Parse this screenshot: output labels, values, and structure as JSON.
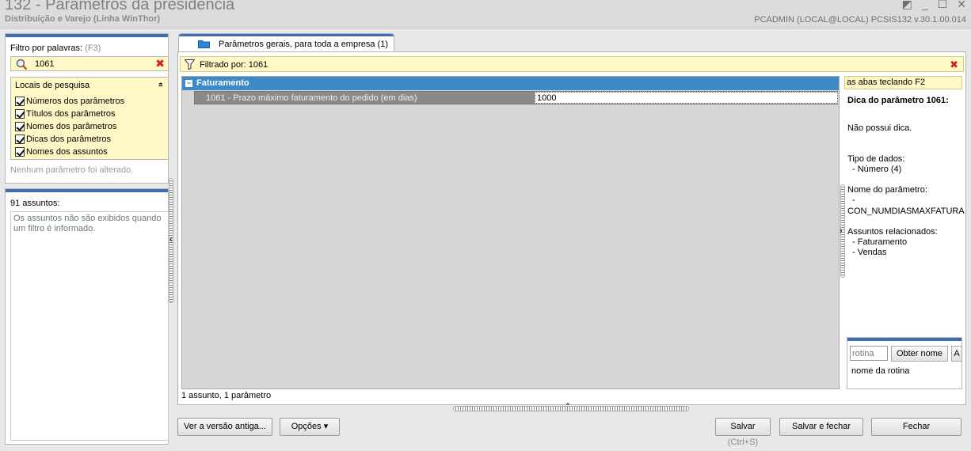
{
  "window": {
    "title": "132 - Parâmetros da presidência",
    "subtitle": "Distribuição e Varejo (Linha WinThor)",
    "user_info": "PCADMIN (LOCAL@LOCAL)   PCSIS132  v.30.1.00.014",
    "controls": {
      "restore": "◩",
      "minimize": "_",
      "maximize": "☐",
      "close": "✕"
    }
  },
  "filter": {
    "label": "Filtro por palavras:",
    "shortcut": "(F3)",
    "value": "1061",
    "clear": "✖"
  },
  "search_locations": {
    "title": "Locais de pesquisa",
    "collapse": "»",
    "items": [
      {
        "label": "Números dos parâmetros",
        "checked": true
      },
      {
        "label": "Títulos dos parâmetros",
        "checked": true
      },
      {
        "label": "Nomes dos parâmetros",
        "checked": true
      },
      {
        "label": "Dicas dos parâmetros",
        "checked": true
      },
      {
        "label": "Nomes dos assuntos",
        "checked": true
      }
    ]
  },
  "no_change_text": "Nenhum parâmetro foi alterado.",
  "subjects": {
    "count_label": "91 assuntos:",
    "message": "Os assuntos não são exibidos quando um filtro é informado."
  },
  "tab": {
    "label": "Parâmetros gerais, para toda a empresa  (1)"
  },
  "filter_bar": {
    "text": "Filtrado por: 1061",
    "close": "✖"
  },
  "grid": {
    "group": {
      "toggle": "−",
      "label": "Faturamento"
    },
    "rows": [
      {
        "name": "1061 - Prazo máximo faturamento do pedido (em dias)",
        "value": "1000"
      }
    ]
  },
  "status_text": "1 assunto, 1 parâmetro",
  "hint": {
    "bar_text": "as abas teclando F2",
    "title": "Dica do parâmetro 1061:",
    "no_hint": "Não possui dica.",
    "data_type_label": "Tipo de dados:",
    "data_type_value": "- Número (4)",
    "param_name_label": "Nome do parâmetro:",
    "param_name_dash": "-",
    "param_name_value": "CON_NUMDIASMAXFATURA",
    "related_label": "Assuntos relacionados:",
    "related": [
      "- Faturamento",
      "- Vendas"
    ]
  },
  "routine": {
    "placeholder": "rotina",
    "get_name_button": "Obter nome",
    "third_button": "A",
    "name_label": "nome da rotina"
  },
  "buttons": {
    "old_version": "Ver a versão antiga...",
    "options": "Opções ▾",
    "save": "Salvar",
    "save_shortcut": "(Ctrl+S)",
    "save_close": "Salvar e fechar",
    "close": "Fechar"
  },
  "colors": {
    "accent_blue": "#3d6fb6",
    "group_blue": "#3d8ac8",
    "highlight_yellow": "#fff8c6",
    "clear_red": "#d02020"
  }
}
